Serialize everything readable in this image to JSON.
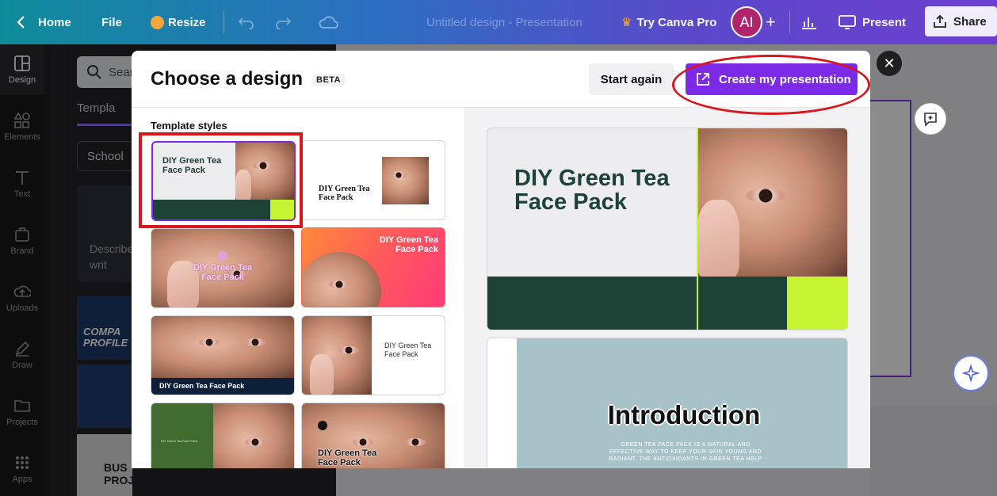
{
  "topbar": {
    "home_label": "Home",
    "file_label": "File",
    "resize_label": "Resize",
    "doc_title": "Untitled design - Presentation",
    "pro_label": "Try Canva Pro",
    "avatar_initials": "AI",
    "present_label": "Present",
    "share_label": "Share"
  },
  "rail": {
    "items": [
      {
        "label": "Design"
      },
      {
        "label": "Elements"
      },
      {
        "label": "Text"
      },
      {
        "label": "Brand"
      },
      {
        "label": "Uploads"
      },
      {
        "label": "Draw"
      },
      {
        "label": "Projects"
      },
      {
        "label": "Apps"
      }
    ]
  },
  "panel": {
    "search_placeholder": "Sear",
    "tab_label": "Templa",
    "filter_value": "School",
    "card_text": "Describe we'll writ",
    "thumb_a_text": "COMPA PROFILE",
    "thumb_c_text": "BUS PROJECT"
  },
  "modal": {
    "title": "Choose a design",
    "beta": "BETA",
    "start_again": "Start again",
    "create": "Create my presentation",
    "section_label": "Template styles",
    "close": "✕"
  },
  "templates": {
    "t1": "DIY Green Tea Face Pack",
    "t2": "DIY Green Tea Face Pack",
    "t3": "DIY Green Tea Face Pack",
    "t4": "DIY Green Tea Face Pack",
    "t5": "DIY Green Tea Face Pack",
    "t6": "DIY Green Tea Face Pack",
    "t7": "DIY Green Tea Face Pack",
    "t8": "DIY Green Tea Face Pack"
  },
  "preview": {
    "slide1_title": "DIY Green Tea Face Pack",
    "slide2_title": "Introduction",
    "slide2_body": "GREEN TEA FACE PACK IS A NATURAL AND EFFECTIVE WAY TO KEEP YOUR SKIN YOUNG AND RADIANT. THE ANTIOXIDANTS IN GREEN TEA HELP"
  },
  "colors": {
    "accent": "#7d2ae8",
    "dark_green": "#1e4236",
    "lime": "#c6f432",
    "annotation_red": "#d8161c"
  }
}
